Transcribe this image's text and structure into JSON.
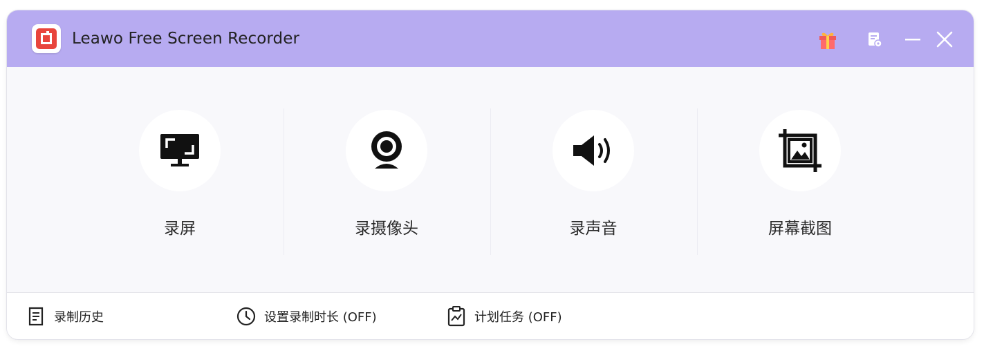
{
  "window": {
    "title": "Leawo Free Screen Recorder"
  },
  "titlebar": {
    "gift_icon": "gift-icon",
    "notes_icon": "document-settings-icon",
    "minimize_icon": "minimize-icon",
    "close_icon": "close-icon",
    "bar_color": "#b7abf1"
  },
  "features": [
    {
      "label": "录屏",
      "icon": "monitor-icon"
    },
    {
      "label": "录摄像头",
      "icon": "webcam-icon"
    },
    {
      "label": "录声音",
      "icon": "speaker-icon"
    },
    {
      "label": "屏幕截图",
      "icon": "screenshot-crop-icon"
    }
  ],
  "bottom": {
    "history_label": "录制历史",
    "duration_label": "设置录制时长 (OFF)",
    "schedule_label": "计划任务 (OFF)"
  }
}
